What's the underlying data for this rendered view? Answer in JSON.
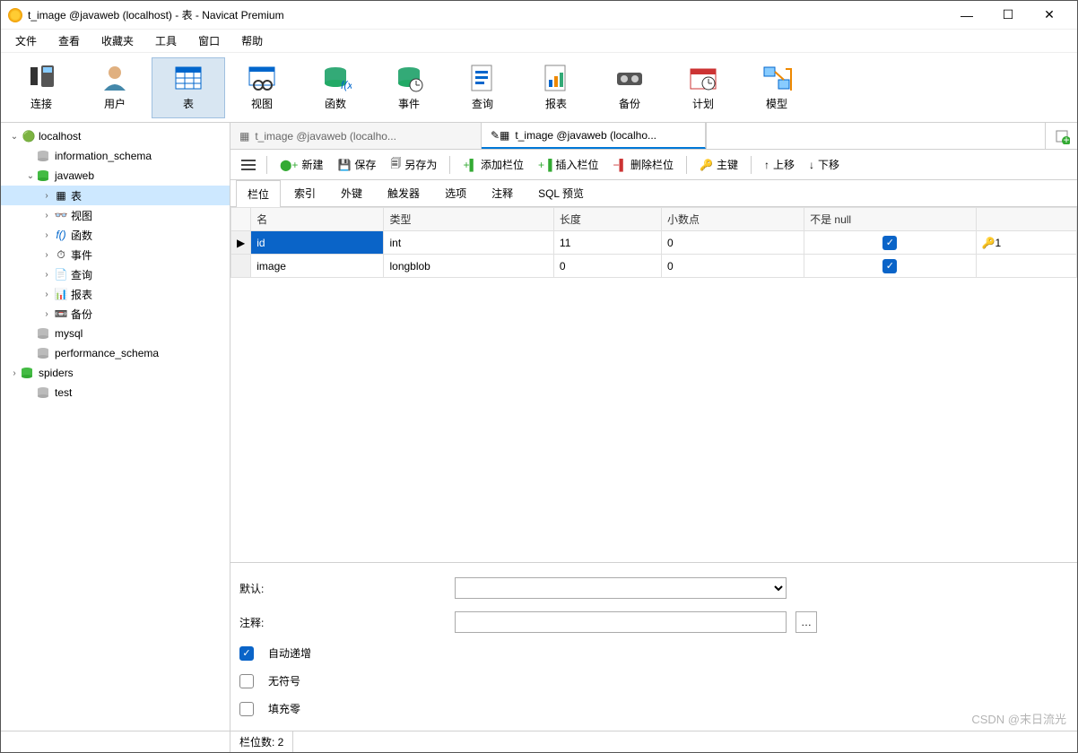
{
  "window": {
    "title": "t_image @javaweb (localhost) - 表 - Navicat Premium"
  },
  "menu": [
    "文件",
    "查看",
    "收藏夹",
    "工具",
    "窗口",
    "帮助"
  ],
  "toolbar": [
    {
      "label": "连接",
      "icon": "plug"
    },
    {
      "label": "用户",
      "icon": "user"
    },
    {
      "label": "表",
      "icon": "table",
      "active": true
    },
    {
      "label": "视图",
      "icon": "view"
    },
    {
      "label": "函数",
      "icon": "fx"
    },
    {
      "label": "事件",
      "icon": "event"
    },
    {
      "label": "查询",
      "icon": "query"
    },
    {
      "label": "报表",
      "icon": "report"
    },
    {
      "label": "备份",
      "icon": "backup"
    },
    {
      "label": "计划",
      "icon": "schedule"
    },
    {
      "label": "模型",
      "icon": "model"
    }
  ],
  "tree": [
    {
      "depth": 0,
      "tw": "v",
      "icon": "🟢",
      "label": "localhost"
    },
    {
      "depth": 1,
      "tw": "",
      "icon": "db",
      "label": "information_schema"
    },
    {
      "depth": 1,
      "tw": "v",
      "icon": "dbon",
      "label": "javaweb"
    },
    {
      "depth": 2,
      "tw": ">",
      "icon": "tbl",
      "label": "表",
      "sel": true
    },
    {
      "depth": 2,
      "tw": ">",
      "icon": "view",
      "label": "视图"
    },
    {
      "depth": 2,
      "tw": ">",
      "icon": "fx",
      "label": "函数"
    },
    {
      "depth": 2,
      "tw": ">",
      "icon": "ev",
      "label": "事件"
    },
    {
      "depth": 2,
      "tw": ">",
      "icon": "qry",
      "label": "查询"
    },
    {
      "depth": 2,
      "tw": ">",
      "icon": "rpt",
      "label": "报表"
    },
    {
      "depth": 2,
      "tw": ">",
      "icon": "bak",
      "label": "备份"
    },
    {
      "depth": 1,
      "tw": "",
      "icon": "db",
      "label": "mysql"
    },
    {
      "depth": 1,
      "tw": "",
      "icon": "db",
      "label": "performance_schema"
    },
    {
      "depth": 0,
      "tw": ">",
      "icon": "dbon",
      "label": "spiders"
    },
    {
      "depth": 1,
      "tw": "",
      "icon": "db",
      "label": "test"
    }
  ],
  "tabs": [
    {
      "label": "t_image @javaweb (localho...",
      "active": false
    },
    {
      "label": "t_image @javaweb (localho...",
      "active": true,
      "dirty": true
    }
  ],
  "subtb": {
    "new": "新建",
    "save": "保存",
    "saveas": "另存为",
    "addfield": "添加栏位",
    "insertfield": "插入栏位",
    "delfield": "删除栏位",
    "pk": "主键",
    "up": "上移",
    "down": "下移"
  },
  "proptabs": [
    "栏位",
    "索引",
    "外键",
    "触发器",
    "选项",
    "注释",
    "SQL 预览"
  ],
  "grid": {
    "headers": [
      "名",
      "类型",
      "长度",
      "小数点",
      "不是 null",
      ""
    ],
    "rows": [
      {
        "name": "id",
        "type": "int",
        "len": "11",
        "dec": "0",
        "nn": true,
        "pk": "1",
        "sel": true
      },
      {
        "name": "image",
        "type": "longblob",
        "len": "0",
        "dec": "0",
        "nn": true,
        "pk": ""
      }
    ]
  },
  "detail": {
    "default_label": "默认:",
    "default_value": "",
    "comment_label": "注释:",
    "comment_value": "",
    "auto_inc": "自动递增",
    "unsigned": "无符号",
    "zerofill": "填充零",
    "auto_inc_on": true,
    "unsigned_on": false,
    "zerofill_on": false
  },
  "status": {
    "fieldcount": "栏位数: 2"
  },
  "watermark": "CSDN @末日流光"
}
